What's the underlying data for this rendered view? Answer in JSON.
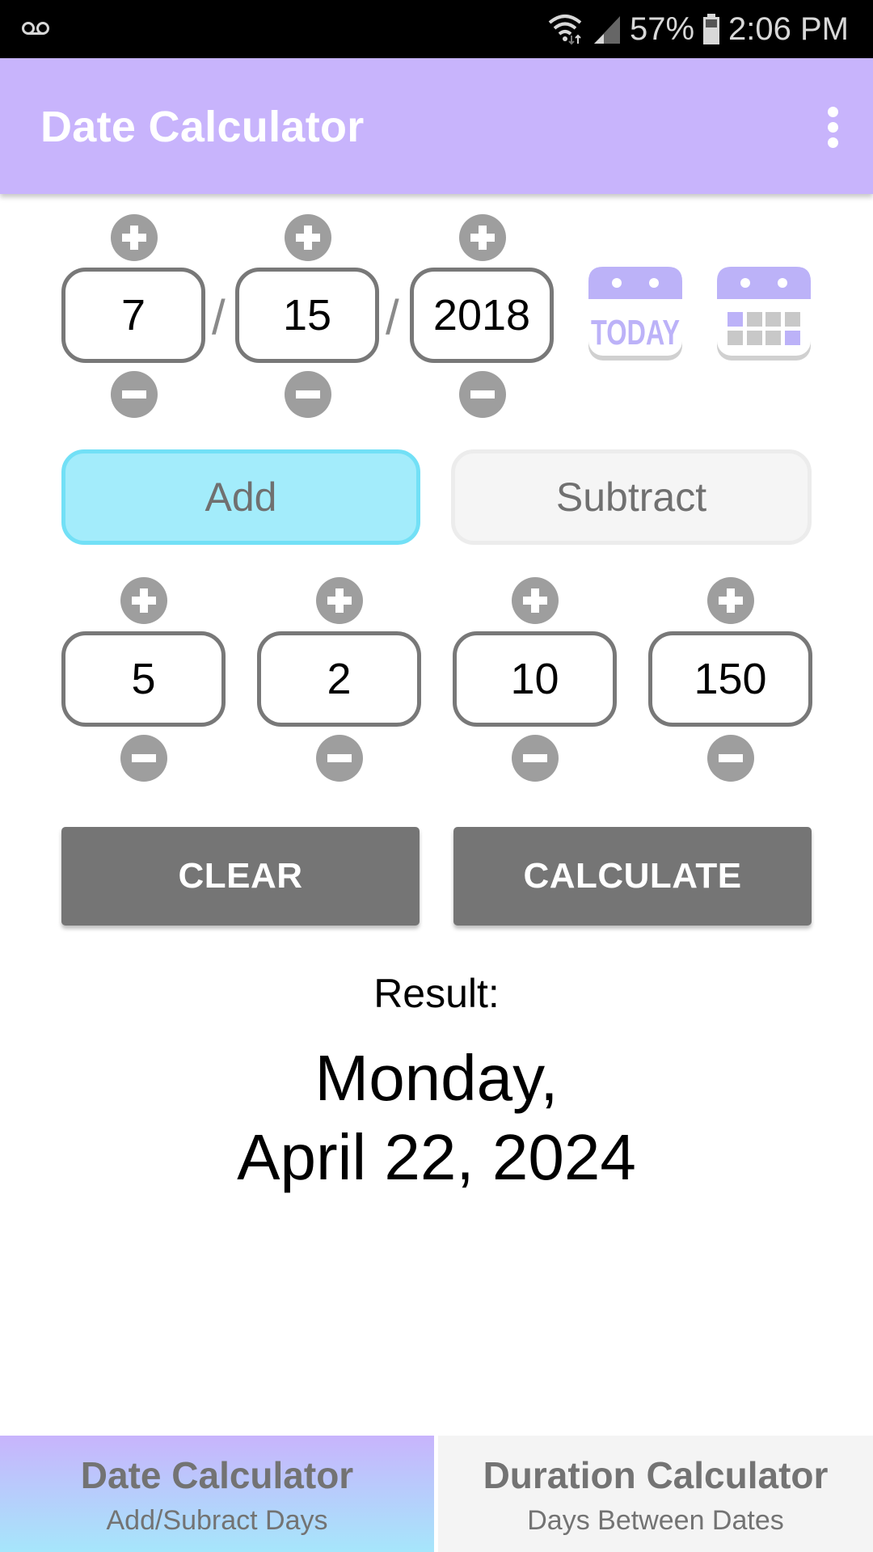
{
  "status_bar": {
    "voicemail_icon": "voicemail-icon",
    "wifi_icon": "wifi-icon",
    "signal_icon": "signal-icon",
    "battery_percent": "57%",
    "battery_icon": "battery-icon",
    "time": "2:06 PM"
  },
  "app_bar": {
    "title": "Date Calculator",
    "menu_icon": "more-vert-icon"
  },
  "start_date": {
    "month": "7",
    "day": "15",
    "year": "2018",
    "separator": "/",
    "today_icon_text": "TODAY",
    "today_button_icon": "calendar-today-icon",
    "picker_button_icon": "calendar-picker-icon"
  },
  "mode": {
    "add_label": "Add",
    "subtract_label": "Subtract",
    "selected": "Add"
  },
  "offsets": {
    "values": [
      "5",
      "2",
      "10",
      "150"
    ]
  },
  "actions": {
    "clear_label": "CLEAR",
    "calculate_label": "CALCULATE"
  },
  "result": {
    "label": "Result:",
    "line1": "Monday,",
    "line2": "April 22, 2024"
  },
  "bottom_nav": {
    "tabs": [
      {
        "title": "Date Calculator",
        "subtitle": "Add/Subract Days",
        "active": true
      },
      {
        "title": "Duration Calculator",
        "subtitle": "Days Between Dates",
        "active": false
      }
    ]
  },
  "colors": {
    "app_bar": "#c8b4fc",
    "add_selected": "#a3ecfb",
    "button_gray": "#757575",
    "stepper_gray": "#9e9e9e",
    "calendar_accent": "#bcb2f8"
  }
}
